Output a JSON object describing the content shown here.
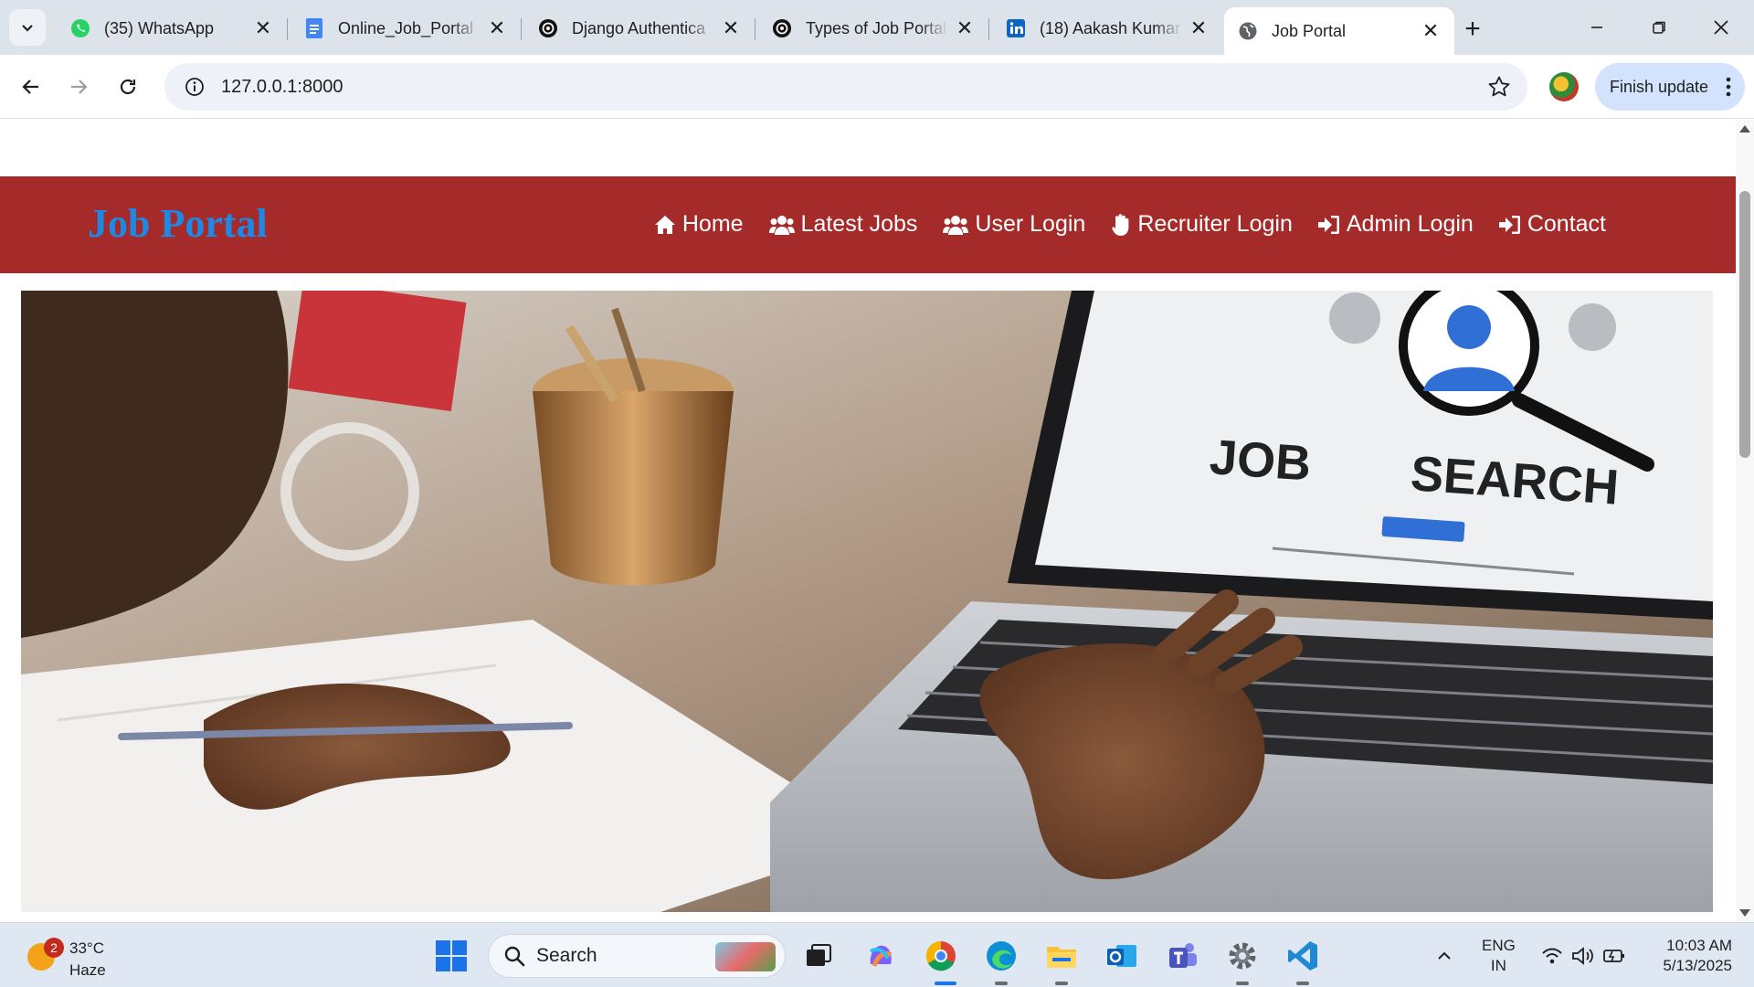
{
  "browser": {
    "tabs": [
      {
        "title": "(35) WhatsApp",
        "icon": "whatsapp-icon"
      },
      {
        "title": "Online_Job_Portal",
        "icon": "docs-icon"
      },
      {
        "title": "Django Authentica",
        "icon": "chatgpt-icon"
      },
      {
        "title": "Types of Job Portal",
        "icon": "chatgpt-icon"
      },
      {
        "title": "(18) Aakash Kumar",
        "icon": "linkedin-icon"
      },
      {
        "title": "Job Portal",
        "icon": "globe-icon",
        "active": true
      }
    ],
    "address": "127.0.0.1:8000",
    "finish_update_label": "Finish update"
  },
  "site": {
    "brand": "Job Portal",
    "brand_color": "#1e88e5",
    "header_color": "#a52a2a",
    "nav": [
      {
        "label": "Home",
        "icon": "home-icon"
      },
      {
        "label": "Latest Jobs",
        "icon": "users-icon"
      },
      {
        "label": "User Login",
        "icon": "users-icon"
      },
      {
        "label": "Recruiter Login",
        "icon": "hand-icon"
      },
      {
        "label": "Admin Login",
        "icon": "sign-in-icon"
      },
      {
        "label": "Contact",
        "icon": "sign-in-icon"
      }
    ],
    "hero_text": {
      "line1": "JOB",
      "line2": "SEARCH"
    }
  },
  "taskbar": {
    "weather": {
      "badge": "2",
      "temp": "33°C",
      "condition": "Haze"
    },
    "search_label": "Search",
    "lang_line1": "ENG",
    "lang_line2": "IN",
    "time": "10:03 AM",
    "date": "5/13/2025"
  }
}
